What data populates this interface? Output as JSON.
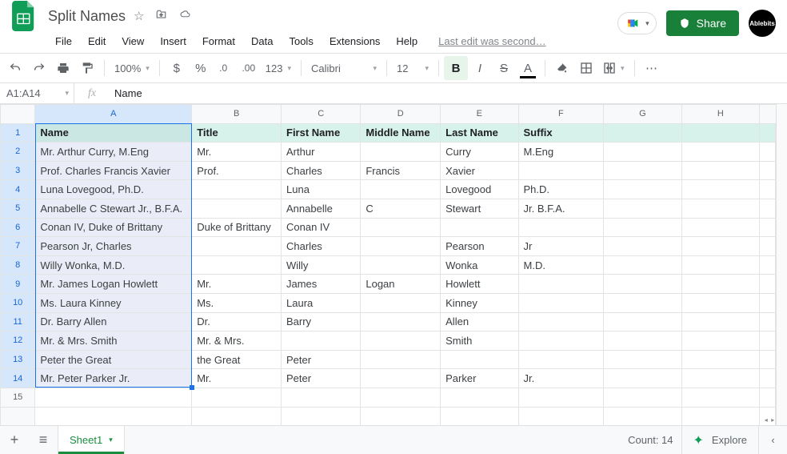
{
  "doc": {
    "title": "Split Names",
    "last_edit": "Last edit was second…"
  },
  "menus": {
    "file": "File",
    "edit": "Edit",
    "view": "View",
    "insert": "Insert",
    "format": "Format",
    "data": "Data",
    "tools": "Tools",
    "extensions": "Extensions",
    "help": "Help"
  },
  "actions": {
    "share": "Share",
    "ablebits": "Ablebits"
  },
  "toolbar": {
    "zoom": "100%",
    "number_format": "123",
    "font": "Calibri",
    "font_size": "12"
  },
  "formula_bar": {
    "range": "A1:A14",
    "value": "Name"
  },
  "columns": [
    "A",
    "B",
    "C",
    "D",
    "E",
    "F",
    "G",
    "H"
  ],
  "headers": {
    "A": "Name",
    "B": "Title",
    "C": "First Name",
    "D": "Middle Name",
    "E": "Last Name",
    "F": "Suffix"
  },
  "rows": [
    {
      "n": "2",
      "A": "Mr. Arthur Curry, M.Eng",
      "B": "Mr.",
      "C": "Arthur",
      "D": "",
      "E": "Curry",
      "F": "M.Eng"
    },
    {
      "n": "3",
      "A": "Prof. Charles Francis Xavier",
      "B": "Prof.",
      "C": "Charles",
      "D": "Francis",
      "E": "Xavier",
      "F": ""
    },
    {
      "n": "4",
      "A": "Luna Lovegood, Ph.D.",
      "B": "",
      "C": "Luna",
      "D": "",
      "E": "Lovegood",
      "F": "Ph.D."
    },
    {
      "n": "5",
      "A": "Annabelle C Stewart Jr., B.F.A.",
      "B": "",
      "C": "Annabelle",
      "D": "C",
      "E": "Stewart",
      "F": "Jr. B.F.A."
    },
    {
      "n": "6",
      "A": "Conan IV, Duke of Brittany",
      "B": "Duke of Brittany",
      "C": "Conan IV",
      "D": "",
      "E": "",
      "F": ""
    },
    {
      "n": "7",
      "A": "Pearson Jr, Charles",
      "B": "",
      "C": "Charles",
      "D": "",
      "E": "Pearson",
      "F": "Jr"
    },
    {
      "n": "8",
      "A": "Willy Wonka, M.D.",
      "B": "",
      "C": "Willy",
      "D": "",
      "E": "Wonka",
      "F": "M.D."
    },
    {
      "n": "9",
      "A": "Mr. James Logan Howlett",
      "B": "Mr.",
      "C": "James",
      "D": "Logan",
      "E": "Howlett",
      "F": ""
    },
    {
      "n": "10",
      "A": "Ms. Laura Kinney",
      "B": "Ms.",
      "C": "Laura",
      "D": "",
      "E": "Kinney",
      "F": ""
    },
    {
      "n": "11",
      "A": "Dr. Barry Allen",
      "B": "Dr.",
      "C": "Barry",
      "D": "",
      "E": "Allen",
      "F": ""
    },
    {
      "n": "12",
      "A": "Mr. & Mrs. Smith",
      "B": "Mr. & Mrs.",
      "C": "",
      "D": "",
      "E": "Smith",
      "F": ""
    },
    {
      "n": "13",
      "A": "Peter the Great",
      "B": "the Great",
      "C": "Peter",
      "D": "",
      "E": "",
      "F": ""
    },
    {
      "n": "14",
      "A": "Mr. Peter Parker Jr.",
      "B": "Mr.",
      "C": "Peter",
      "D": "",
      "E": "Parker",
      "F": "Jr."
    }
  ],
  "blank_rows": [
    "15"
  ],
  "tabs": {
    "sheet1": "Sheet1"
  },
  "status": {
    "count": "Count: 14",
    "explore": "Explore"
  }
}
